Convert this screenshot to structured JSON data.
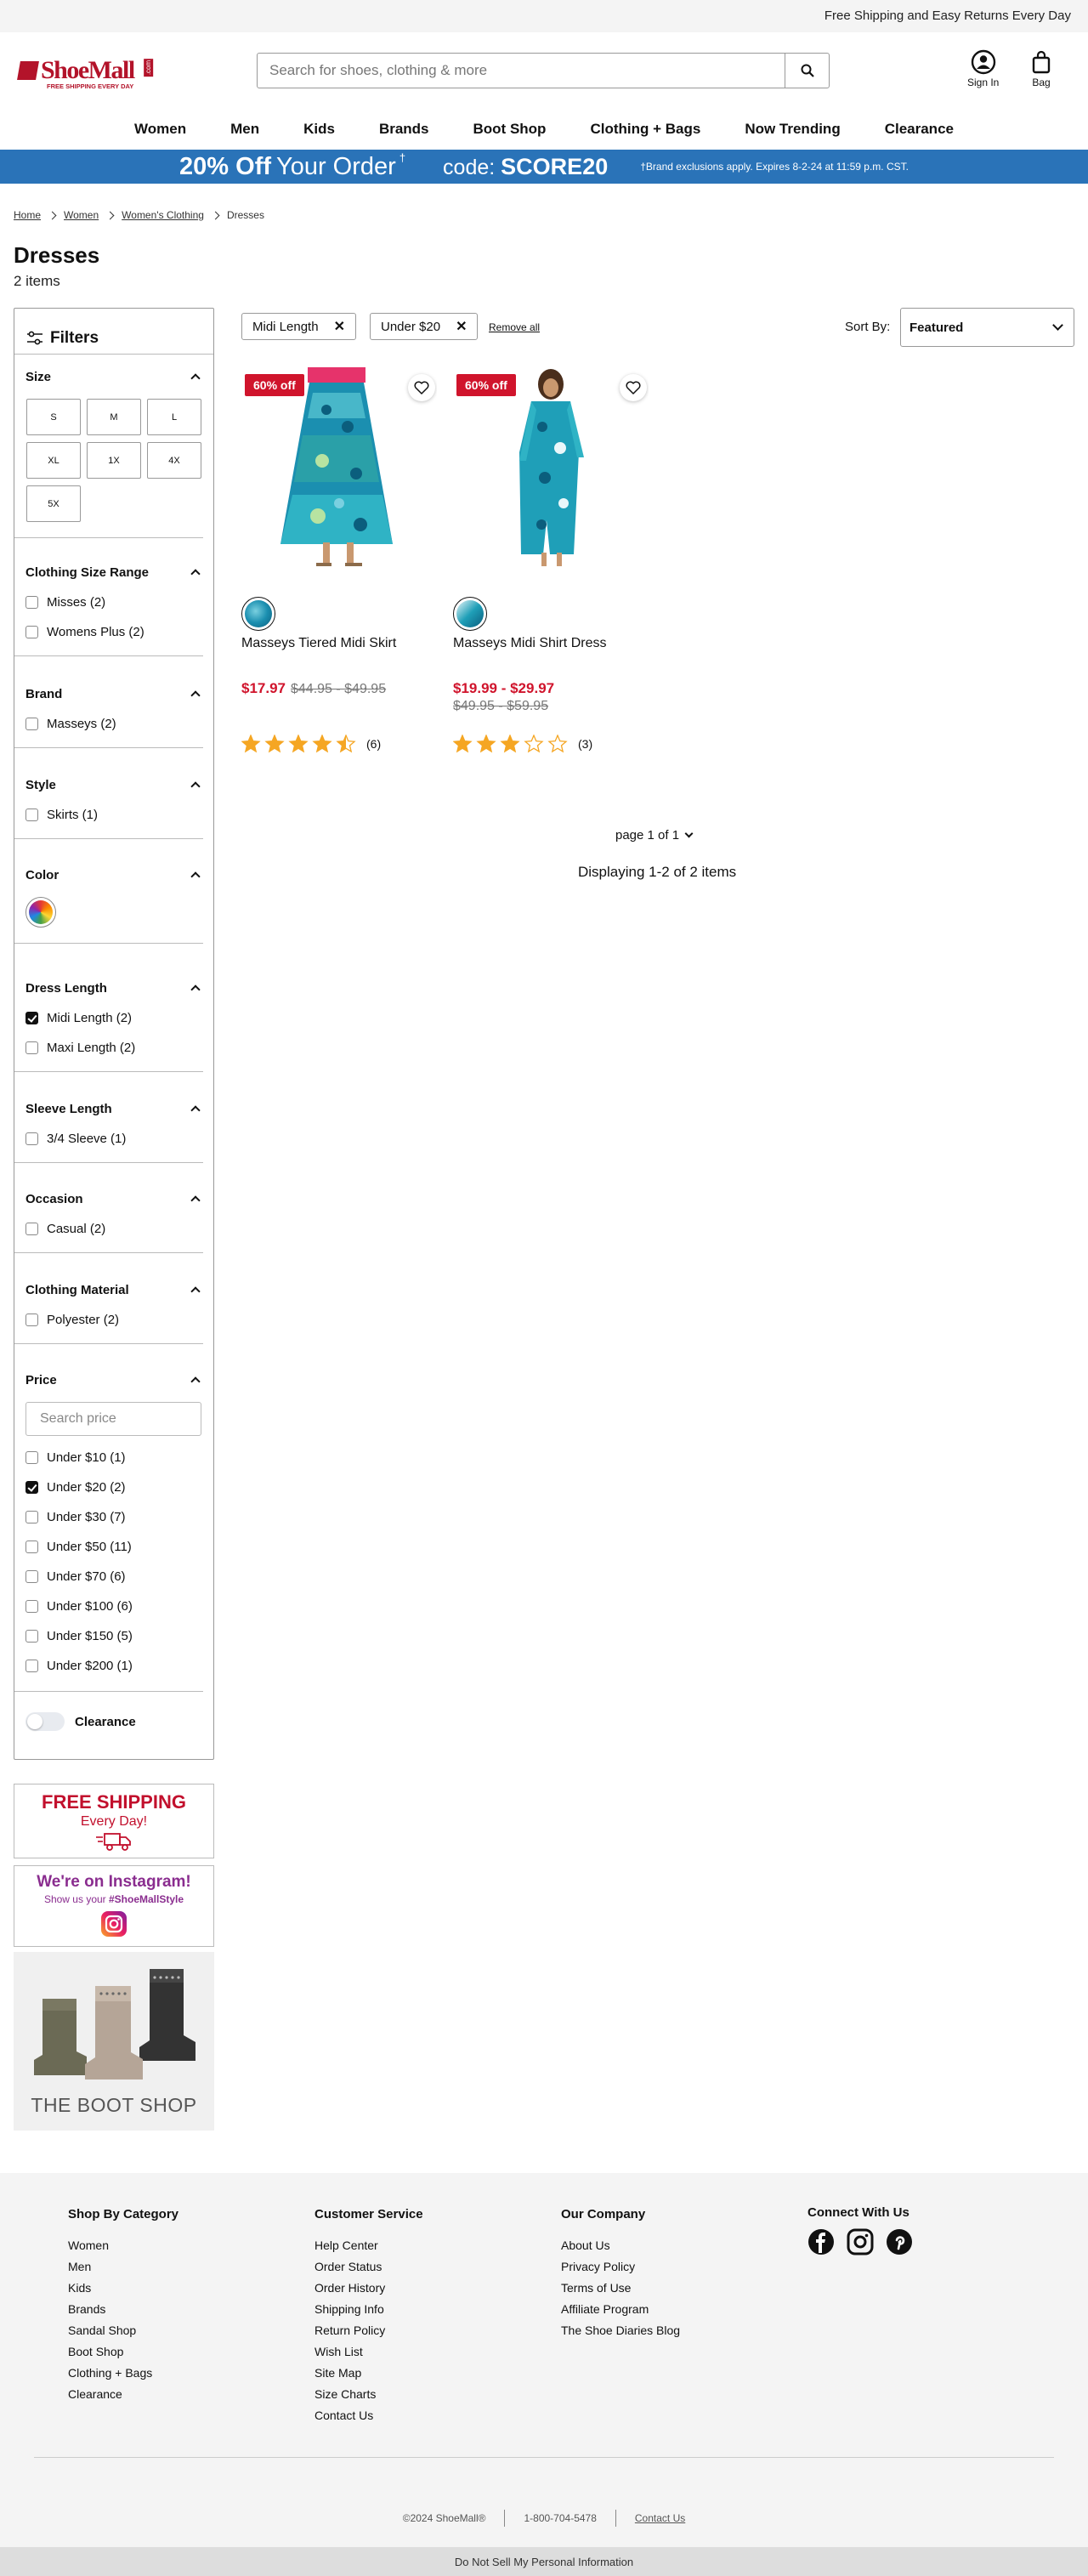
{
  "topbar": {
    "message": "Free Shipping and Easy Returns Every Day"
  },
  "header": {
    "logo_text": "ShoeMall",
    "logo_dotcom": ".com",
    "logo_tagline": "FREE SHIPPING EVERY DAY",
    "search_placeholder": "Search for shoes, clothing & more",
    "sign_in": "Sign In",
    "bag": "Bag"
  },
  "nav": [
    "Women",
    "Men",
    "Kids",
    "Brands",
    "Boot Shop",
    "Clothing + Bags",
    "Now Trending",
    "Clearance"
  ],
  "promo": {
    "offer_bold": "20% Off",
    "offer_rest": "Your Order",
    "dagger": "†",
    "code_label": "code:",
    "code": "SCORE20",
    "note": "†Brand exclusions apply. Expires 8-2-24 at 11:59 p.m. CST."
  },
  "breadcrumb": [
    "Home",
    "Women",
    "Women's Clothing",
    "Dresses"
  ],
  "page": {
    "title": "Dresses",
    "count": "2 items"
  },
  "filters": {
    "title": "Filters",
    "size": {
      "title": "Size",
      "options": [
        "S",
        "M",
        "L",
        "XL",
        "1X",
        "4X",
        "5X"
      ]
    },
    "clothing_size_range": {
      "title": "Clothing Size Range",
      "options": [
        "Misses (2)",
        "Womens Plus (2)"
      ]
    },
    "brand": {
      "title": "Brand",
      "options": [
        "Masseys (2)"
      ]
    },
    "style": {
      "title": "Style",
      "options": [
        "Skirts (1)"
      ]
    },
    "color": {
      "title": "Color",
      "swatch": "multi-color"
    },
    "dress_length": {
      "title": "Dress Length",
      "options": [
        "Midi Length (2)",
        "Maxi Length (2)"
      ],
      "checked": [
        true,
        false
      ]
    },
    "sleeve_length": {
      "title": "Sleeve Length",
      "options": [
        "3/4 Sleeve (1)"
      ]
    },
    "occasion": {
      "title": "Occasion",
      "options": [
        "Casual (2)"
      ]
    },
    "material": {
      "title": "Clothing Material",
      "options": [
        "Polyester (2)"
      ]
    },
    "price": {
      "title": "Price",
      "placeholder": "Search price",
      "options": [
        "Under $10 (1)",
        "Under $20 (2)",
        "Under $30 (7)",
        "Under $50 (11)",
        "Under $70 (6)",
        "Under $100 (6)",
        "Under $150 (5)",
        "Under $200 (1)"
      ],
      "checked": [
        false,
        true,
        false,
        false,
        false,
        false,
        false,
        false
      ]
    },
    "clearance": "Clearance"
  },
  "banners": {
    "shipping_title": "FREE SHIPPING",
    "shipping_sub": "Every Day!",
    "insta_title": "We're on Instagram!",
    "insta_sub": "Show us your",
    "insta_tag": "#ShoeMallStyle",
    "boot_shop": "THE BOOT SHOP"
  },
  "applied": {
    "chips": [
      "Midi Length",
      "Under $20"
    ],
    "remove_all": "Remove all"
  },
  "sort": {
    "label": "Sort By:",
    "value": "Featured"
  },
  "products": [
    {
      "name": "Masseys Tiered Midi Skirt",
      "badge": "60% off",
      "price": "$17.97",
      "was": "$44.95 - $49.95",
      "rating": 4.5,
      "reviews": "(6)"
    },
    {
      "name": "Masseys Midi Shirt Dress",
      "badge": "60% off",
      "price": "$19.99 - $29.97",
      "was": "$49.95 - $59.95",
      "rating": 3,
      "reviews": "(3)"
    }
  ],
  "pagination": {
    "label": "page 1 of 1",
    "displaying": "Displaying 1-2 of 2 items"
  },
  "footer": {
    "col1": {
      "title": "Shop By Category",
      "links": [
        "Women",
        "Men",
        "Kids",
        "Brands",
        "Sandal Shop",
        "Boot Shop",
        "Clothing + Bags",
        "Clearance"
      ]
    },
    "col2": {
      "title": "Customer Service",
      "links": [
        "Help Center",
        "Order Status",
        "Order History",
        "Shipping Info",
        "Return Policy",
        "Wish List",
        "Site Map",
        "Size Charts",
        "Contact Us"
      ]
    },
    "col3": {
      "title": "Our Company",
      "links": [
        "About Us",
        "Privacy Policy",
        "Terms of Use",
        "Affiliate Program",
        "The Shoe Diaries Blog"
      ]
    },
    "col4": {
      "title": "Connect With Us"
    },
    "copyright": "©2024 ShoeMall®",
    "phone": "1-800-704-5478",
    "contact": "Contact Us",
    "do_not_sell": "Do Not Sell My Personal Information"
  },
  "colors": {
    "brand_red": "#b3132a",
    "promo_blue": "#2a73b8",
    "sale_red": "#d0142c",
    "star": "#f5a623"
  }
}
